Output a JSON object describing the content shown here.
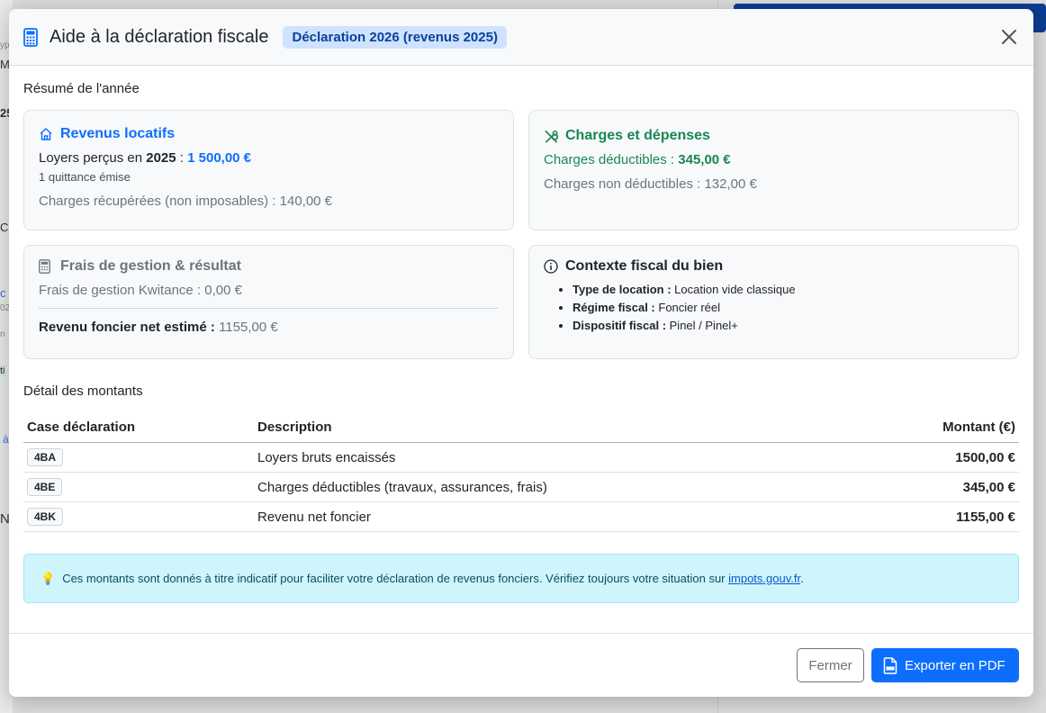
{
  "background": {
    "fragments": [
      "yp",
      "M",
      "25",
      "C",
      "c",
      "02",
      "n",
      "ti",
      "à",
      "N"
    ]
  },
  "modal": {
    "title": "Aide à la déclaration fiscale",
    "badge": "Déclaration 2026 (revenus 2025)",
    "icons": {
      "header": "calculator-icon",
      "close": "close-icon"
    },
    "summary_title": "Résumé de l'année",
    "rental_income": {
      "title": "Revenus locatifs",
      "rent_label": "Loyers perçus en ",
      "year": "2025",
      "sep": " : ",
      "rent_value": "1 500,00 €",
      "receipts": "1 quittance émise",
      "recovered_charges": "Charges récupérées (non imposables) : 140,00 €"
    },
    "charges": {
      "title": "Charges et dépenses",
      "deductible_label": "Charges déductibles : ",
      "deductible_value": "345,00 €",
      "non_deductible": "Charges non déductibles : 132,00 €"
    },
    "fees": {
      "title": "Frais de gestion & résultat",
      "management_fees": "Frais de gestion Kwitance : 0,00 €",
      "net_label": "Revenu foncier net estimé : ",
      "net_value": "1155,00 €"
    },
    "context": {
      "title": "Contexte fiscal du bien",
      "items": [
        {
          "label": "Type de location : ",
          "value": "Location vide classique"
        },
        {
          "label": "Régime fiscal : ",
          "value": "Foncier réel"
        },
        {
          "label": "Dispositif fiscal : ",
          "value": "Pinel / Pinel+"
        }
      ]
    },
    "detail_title": "Détail des montants",
    "table": {
      "headers": [
        "Case déclaration",
        "Description",
        "Montant (€)"
      ],
      "rows": [
        {
          "case": "4BA",
          "description": "Loyers bruts encaissés",
          "amount": "1500,00 €"
        },
        {
          "case": "4BE",
          "description": "Charges déductibles (travaux, assurances, frais)",
          "amount": "345,00 €"
        },
        {
          "case": "4BK",
          "description": "Revenu net foncier",
          "amount": "1155,00 €"
        }
      ]
    },
    "alert": {
      "icon": "💡",
      "text": "Ces montants sont donnés à titre indicatif pour faciliter votre déclaration de revenus fonciers. Vérifiez toujours votre situation sur ",
      "link": "impots.gouv.fr",
      "after": "."
    },
    "footer": {
      "close_label": "Fermer",
      "export_label": "Exporter en PDF"
    }
  },
  "colors": {
    "primary": "#0d6efd",
    "success": "#198754",
    "muted": "#6c757d",
    "info_bg": "#cff4fc",
    "badge_bg": "#cfe2ff"
  }
}
